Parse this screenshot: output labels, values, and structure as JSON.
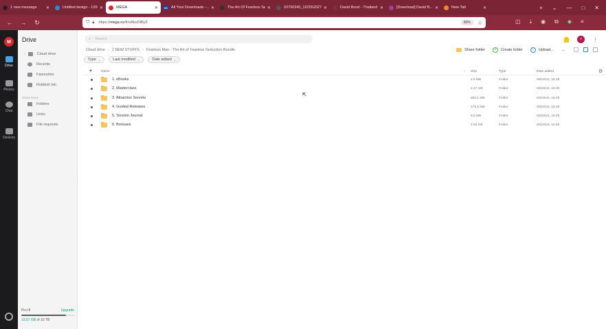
{
  "browser": {
    "tabs": [
      {
        "label": "1 new message",
        "color": "#222"
      },
      {
        "label": "Untitled design - 1200...",
        "color": "#2f8bd3"
      },
      {
        "label": "MEGA",
        "color": "#d9272e",
        "active": true
      },
      {
        "label": "All Your Downloads -...",
        "color": "#1b3fa8",
        "badge": "XC"
      },
      {
        "label": "The Art Of Fearless Se...",
        "color": "#333"
      },
      {
        "label": "20796340_1625520274...",
        "color": "#555"
      },
      {
        "label": "David Bond - Thailand",
        "color": "#8a2a3d"
      },
      {
        "label": "[Download] David B...",
        "color": "#a23fa0"
      },
      {
        "label": "New Tab",
        "color": "#f08a24"
      }
    ],
    "url_prefix": "https://",
    "url_host": "mega.nz",
    "url_path": "/fm/AbsDtBy5",
    "zoom": "80%",
    "new_tab": "+",
    "tab_list": "⌄",
    "win_min": "—",
    "win_max": "□",
    "win_close": "✕"
  },
  "rail": {
    "logo": "M",
    "items": [
      {
        "label": "Drive",
        "active": true
      },
      {
        "label": "Photos"
      },
      {
        "label": "Chat"
      },
      {
        "label": "Devices"
      }
    ]
  },
  "sidebar": {
    "title": "Drive",
    "cloud_drive": "Cloud drive",
    "recents": "Recents",
    "favourites": "Favourites",
    "rubbish": "Rubbish bin",
    "section": "Share items",
    "folders": "Folders",
    "links": "Links",
    "file_requests": "File requests",
    "plan": "Pro III",
    "upgrade": "Upgrade",
    "used": "13.57 GB",
    "total": " of 16 TB",
    "used_fraction": 0.85
  },
  "main": {
    "search_placeholder": "Search",
    "avatar": "T",
    "breadcrumb": [
      "Cloud drive",
      "1 NEW STUFFS",
      "Fearless Man - The Art of Fearless Seduction Bundle"
    ],
    "share_folder": "Share folder",
    "create_folder": "Create folder",
    "upload": "Upload...",
    "filters": [
      "Type",
      "Last modified",
      "Date added"
    ],
    "columns": {
      "name": "Name",
      "size": "Size",
      "type": "Type",
      "date": "Date added"
    },
    "rows": [
      {
        "name": "1. eBooks",
        "size": "2.5 MB",
        "type": "Folder",
        "date": "6/6/2024, 16:49"
      },
      {
        "name": "2. Masterclass",
        "size": "2.27 GB",
        "type": "Folder",
        "date": "6/6/2024, 16:49"
      },
      {
        "name": "3. Attraction Secrets",
        "size": "863.1 MB",
        "type": "Folder",
        "date": "6/6/2024, 16:49"
      },
      {
        "name": "4. Guided Releases",
        "size": "179.6 MB",
        "type": "Folder",
        "date": "6/6/2024, 16:49"
      },
      {
        "name": "5. Tension Journal",
        "size": "5.5 MB",
        "type": "Folder",
        "date": "6/6/2024, 16:49"
      },
      {
        "name": "6. Bonuses",
        "size": "1.53 GB",
        "type": "Folder",
        "date": "6/6/2024, 16:49"
      }
    ]
  },
  "colors": {
    "tabbar": "#7b2436",
    "navbar": "#8a2a3d",
    "rail": "#1b1b1d",
    "mega_red": "#d9272e",
    "folder": "#f6c55e",
    "upgrade_green": "#00a382"
  }
}
